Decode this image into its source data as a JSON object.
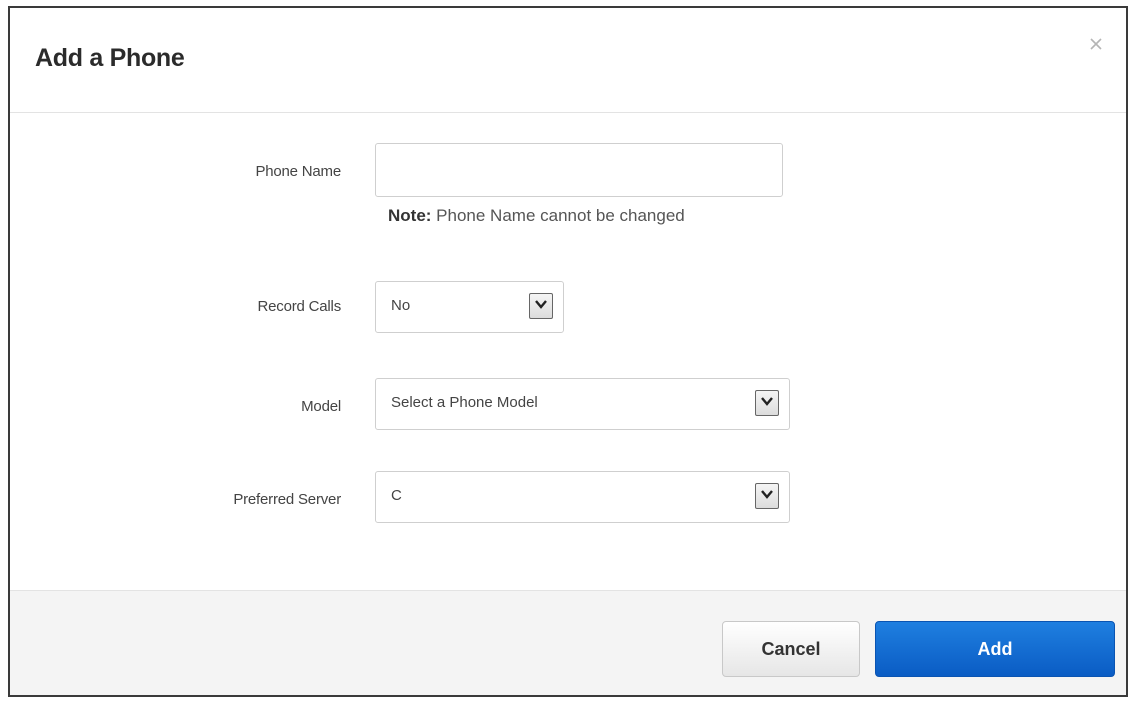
{
  "dialog": {
    "title": "Add a Phone",
    "close_icon": "close-icon"
  },
  "form": {
    "phone_name": {
      "label": "Phone Name",
      "value": "",
      "note_bold": "Note:",
      "note_text": " Phone Name cannot be changed"
    },
    "record_calls": {
      "label": "Record Calls",
      "selected": "No"
    },
    "model": {
      "label": "Model",
      "selected": "Select a Phone Model"
    },
    "preferred_server": {
      "label": "Preferred Server",
      "selected": "C"
    }
  },
  "footer": {
    "cancel_label": "Cancel",
    "add_label": "Add"
  },
  "colors": {
    "primary": "#0a5cc4",
    "footer_bg": "#f4f4f4"
  }
}
